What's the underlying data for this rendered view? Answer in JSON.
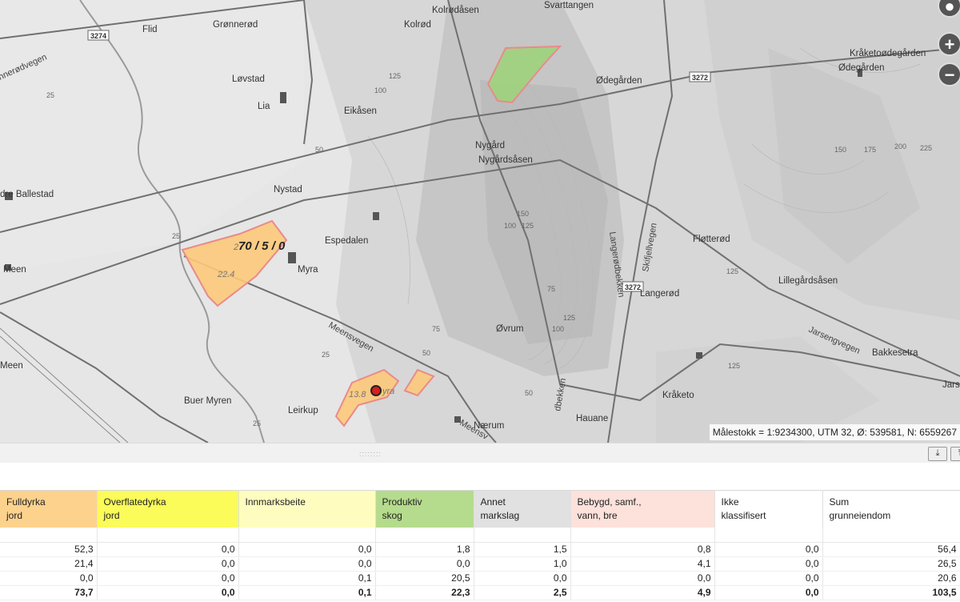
{
  "map": {
    "places": [
      {
        "id": "flid",
        "text": "Flid"
      },
      {
        "id": "gronnerod",
        "text": "Grønnerød"
      },
      {
        "id": "lovstad",
        "text": "Løvstad"
      },
      {
        "id": "lia",
        "text": "Lia"
      },
      {
        "id": "eikasen",
        "text": "Eikåsen"
      },
      {
        "id": "nystad",
        "text": "Nystad"
      },
      {
        "id": "ballestad",
        "text": "dre Ballestad"
      },
      {
        "id": "espedalen",
        "text": "Espedalen"
      },
      {
        "id": "myra",
        "text": "Myra"
      },
      {
        "id": "meen1",
        "text": "Meen"
      },
      {
        "id": "meen2",
        "text": "Meen"
      },
      {
        "id": "buer",
        "text": "Buer Myren"
      },
      {
        "id": "leirkup",
        "text": "Leirkup"
      },
      {
        "id": "kolrodasen",
        "text": "Kolrødåsen"
      },
      {
        "id": "kolrod",
        "text": "Kolrød"
      },
      {
        "id": "svarttangen",
        "text": "Svarttangen"
      },
      {
        "id": "odegarden1",
        "text": "Ødegården"
      },
      {
        "id": "kraketoodegarden",
        "text": "Kråketoødegården"
      },
      {
        "id": "odegarden2",
        "text": "Ødegården"
      },
      {
        "id": "nygard",
        "text": "Nygård"
      },
      {
        "id": "nygardsasen",
        "text": "Nygårdsåsen"
      },
      {
        "id": "flotterod",
        "text": "Fløtterød"
      },
      {
        "id": "langerod",
        "text": "Langerød"
      },
      {
        "id": "lillegardsasen",
        "text": "Lillegårdsåsen"
      },
      {
        "id": "ovrum",
        "text": "Øvrum"
      },
      {
        "id": "bakkesetra",
        "text": "Bakkesetra"
      },
      {
        "id": "kraketo",
        "text": "Kråketo"
      },
      {
        "id": "hauane",
        "text": "Hauane"
      },
      {
        "id": "naerum",
        "text": "Nærum"
      },
      {
        "id": "jars",
        "text": "Jars"
      }
    ],
    "roads": [
      {
        "id": "r3274",
        "text": "3274"
      },
      {
        "id": "r3272a",
        "text": "3272"
      },
      {
        "id": "r3272b",
        "text": "3272"
      },
      {
        "id": "gronnerodvegen",
        "text": "nnerødvegen"
      },
      {
        "id": "meensvegen",
        "text": "Meensvegen"
      },
      {
        "id": "meensv2",
        "text": "Meensv"
      },
      {
        "id": "langerodbekken",
        "text": "Langerødbekken"
      },
      {
        "id": "skifjellvegen",
        "text": "Skifjellvegen"
      },
      {
        "id": "jarsengvegen",
        "text": "Jarsengvegen"
      },
      {
        "id": "bekken2",
        "text": "dbekken"
      }
    ],
    "contours": [
      "25",
      "100",
      "125",
      "50",
      "25",
      "150",
      "125",
      "100",
      "50",
      "75",
      "25",
      "50",
      "75",
      "100",
      "125",
      "125",
      "125",
      "150",
      "175",
      "200",
      "225",
      "25"
    ],
    "parcel_labels": {
      "main": "70 / 5 / 0",
      "area1": "22.4",
      "area2": "2",
      "area3": "13.8",
      "area3b": "yra"
    },
    "controls": {
      "zoom_in": "+",
      "zoom_out": "−"
    },
    "scale_text": "Målestokk = 1:9234300, UTM 32, Ø: 539581, N: 6559267"
  },
  "toolbar": {
    "grip": "::::::::",
    "btn1": "⤓",
    "btn2": "⤒"
  },
  "table": {
    "columns": [
      {
        "line1": "Fulldyrka",
        "line2": "jord",
        "color": "#fdd28d"
      },
      {
        "line1": "Overflatedyrka",
        "line2": "jord",
        "color": "#fbfb5a"
      },
      {
        "line1": "Innmarksbeite",
        "line2": "",
        "color": "#fefdbf"
      },
      {
        "line1": "Produktiv",
        "line2": "skog",
        "color": "#b5db8c"
      },
      {
        "line1": "Annet",
        "line2": "markslag",
        "color": "#e1e1e1"
      },
      {
        "line1": "Bebygd, samf.,",
        "line2": "vann, bre",
        "color": "#fde1db"
      },
      {
        "line1": "Ikke",
        "line2": "klassifisert",
        "color": "#ffffff"
      },
      {
        "line1": "Sum",
        "line2": "grunneiendom",
        "color": "#ffffff"
      }
    ],
    "rows": [
      [
        "52,3",
        "0,0",
        "0,0",
        "1,8",
        "1,5",
        "0,8",
        "0,0",
        "56,4"
      ],
      [
        "21,4",
        "0,0",
        "0,0",
        "0,0",
        "1,0",
        "4,1",
        "0,0",
        "26,5"
      ],
      [
        "0,0",
        "0,0",
        "0,1",
        "20,5",
        "0,0",
        "0,0",
        "0,0",
        "20,6"
      ]
    ],
    "totals": [
      "73,7",
      "0,0",
      "0,1",
      "22,3",
      "2,5",
      "4,9",
      "0,0",
      "103,5"
    ]
  }
}
